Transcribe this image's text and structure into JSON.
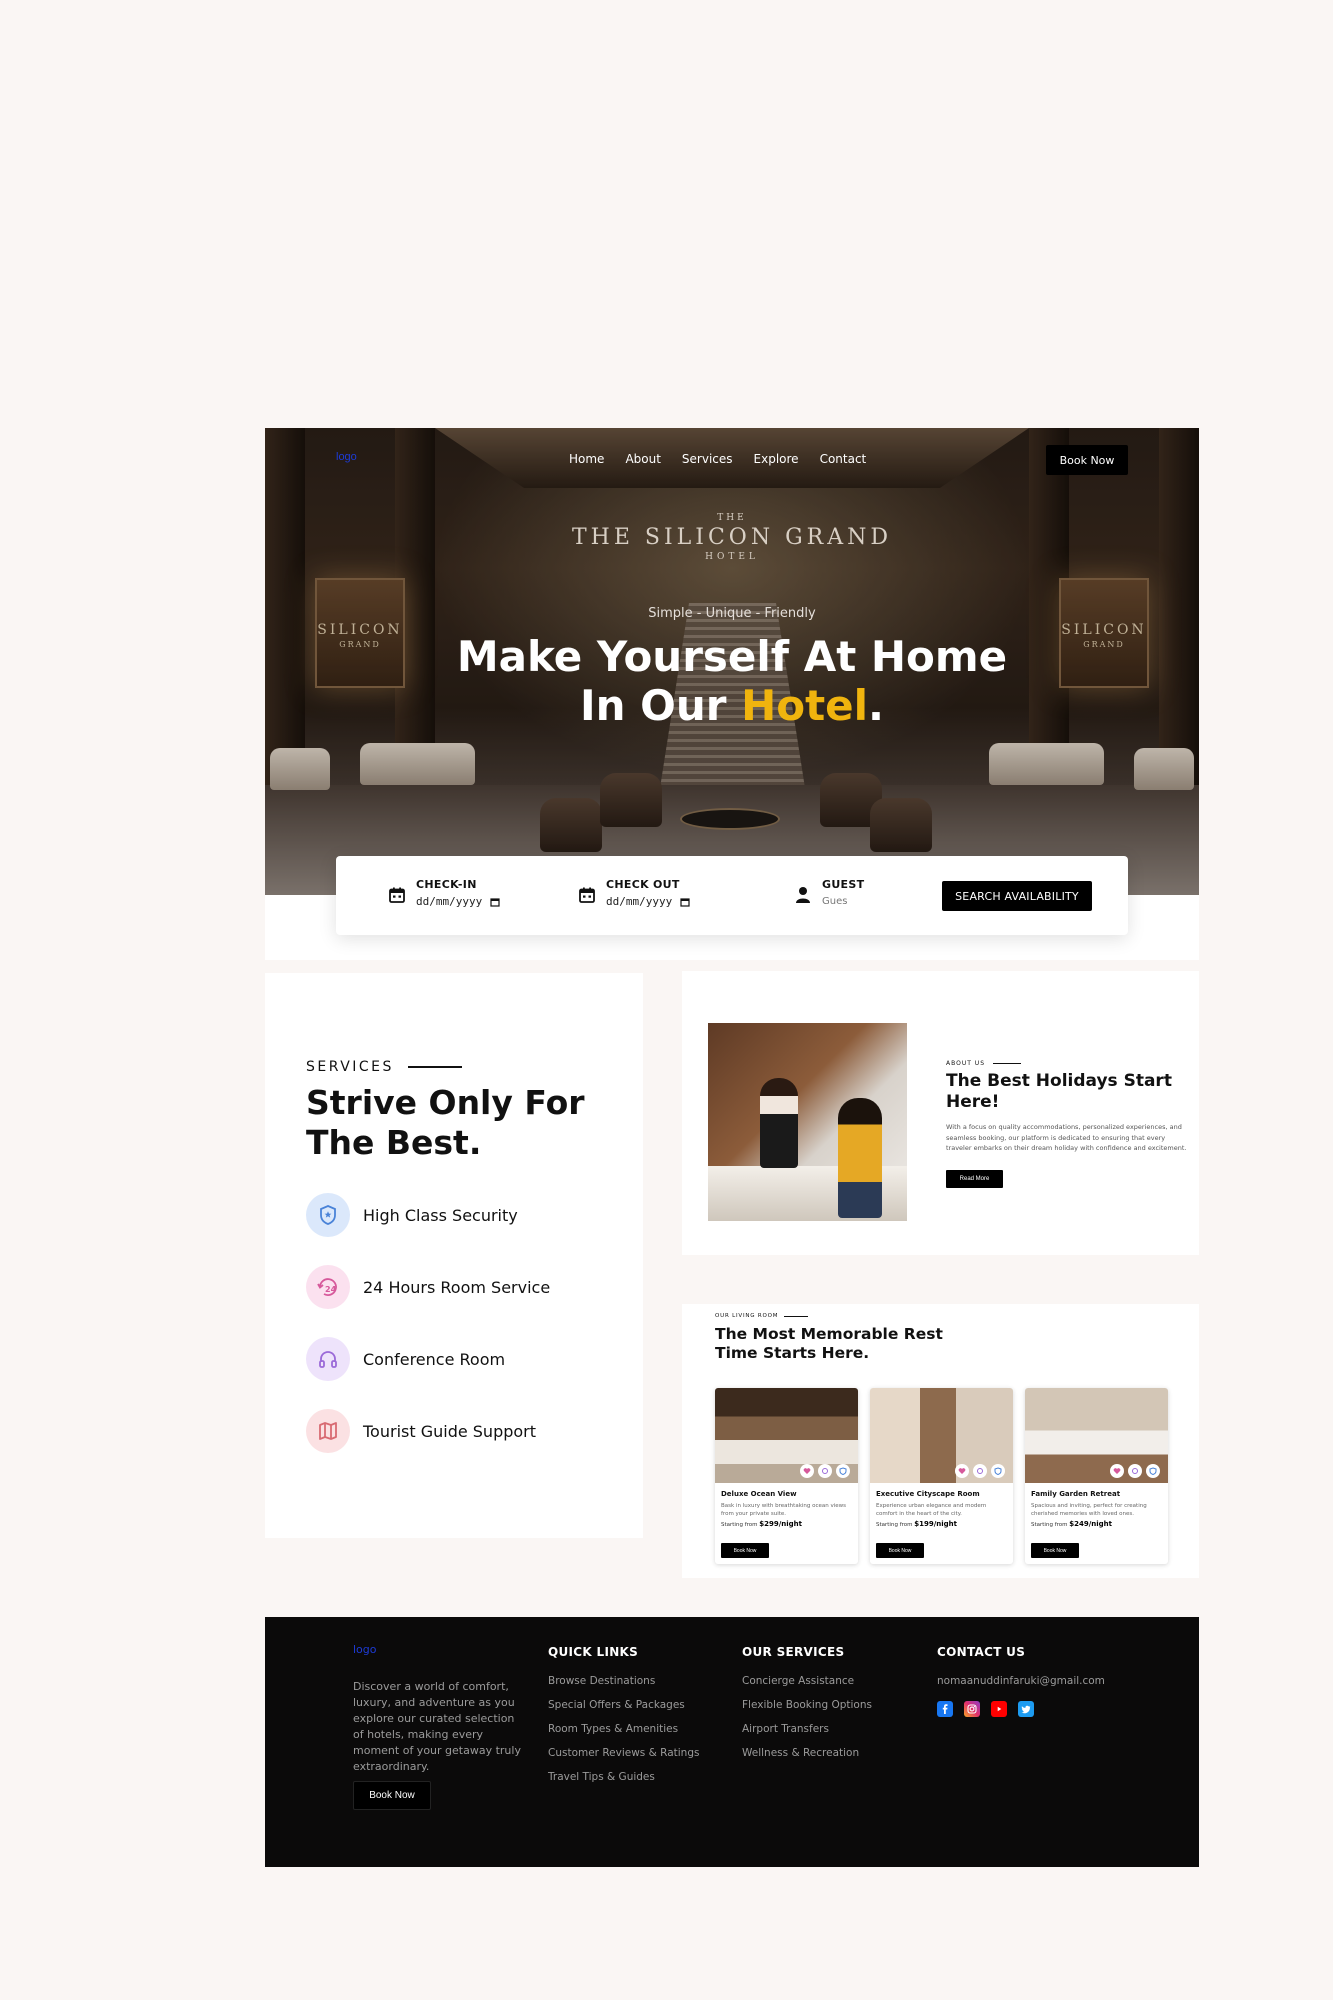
{
  "nav": {
    "logo_alt": "logo",
    "links": [
      "Home",
      "About",
      "Services",
      "Explore",
      "Contact"
    ],
    "book_label": "Book Now"
  },
  "hero": {
    "sign_pre": "THE",
    "sign_main": "THE SILICON GRAND",
    "sign_post": "HOTEL",
    "panel_main": "SILICON",
    "panel_sub": "GRAND",
    "tagline": "Simple - Unique - Friendly",
    "title_line1": "Make Yourself At Home",
    "title_line2_prefix": "In Our ",
    "title_accent": "Hotel",
    "title_suffix": ".",
    "accent_color": "#f0b40e"
  },
  "booking": {
    "checkin_label": "CHECK-IN",
    "checkin_value": "dd/mm/yyyy",
    "checkout_label": "CHECK OUT",
    "checkout_value": "dd/mm/yyyy",
    "guest_label": "GUEST",
    "guest_placeholder": "Gues",
    "search_label": "SEARCH AVAILABILITY"
  },
  "services": {
    "eyebrow": "SERVICES",
    "title": "Strive Only For The Best.",
    "items": [
      {
        "label": "High Class Security",
        "icon": "shield-icon",
        "bg": "#dbe8fb",
        "color": "#4a83d8"
      },
      {
        "label": "24 Hours Room Service",
        "icon": "24-hours-icon",
        "bg": "#fbe1ef",
        "color": "#d6599b"
      },
      {
        "label": "Conference Room",
        "icon": "headphones-icon",
        "bg": "#eee3fb",
        "color": "#9b6ad8"
      },
      {
        "label": "Tourist Guide Support",
        "icon": "map-icon",
        "bg": "#fbe1e3",
        "color": "#d86a72"
      }
    ]
  },
  "about": {
    "eyebrow": "ABOUT US",
    "title": "The Best Holidays Start Here!",
    "text": "With a focus on quality accommodations, personalized experiences, and seamless booking, our platform is dedicated to ensuring that every traveler embarks on their dream holiday with confidence and excitement.",
    "button": "Read More"
  },
  "rooms": {
    "eyebrow": "OUR LIVING ROOM",
    "title": "The Most Memorable Rest Time Starts Here.",
    "items": [
      {
        "name": "Deluxe Ocean View",
        "desc": "Bask in luxury with breathtaking ocean views from your private suite.",
        "price_prefix": "Starting from ",
        "price": "$299",
        "price_suffix": "/night",
        "button": "Book Now"
      },
      {
        "name": "Executive Cityscape Room",
        "desc": "Experience urban elegance and modern comfort in the heart of the city.",
        "price_prefix": "Starting from ",
        "price": "$199",
        "price_suffix": "/night",
        "button": "Book Now"
      },
      {
        "name": "Family Garden Retreat",
        "desc": "Spacious and inviting, perfect for creating cherished memories with loved ones.",
        "price_prefix": "Starting from ",
        "price": "$249",
        "price_suffix": "/night",
        "button": "Book Now"
      }
    ]
  },
  "footer": {
    "logo_alt": "logo",
    "about": "Discover a world of comfort, luxury, and adventure as you explore our curated selection of hotels, making every moment of your getaway truly extraordinary.",
    "book_label": "Book Now",
    "quick_links_title": "QUICK LINKS",
    "quick_links": [
      "Browse Destinations",
      "Special Offers & Packages",
      "Room Types & Amenities",
      "Customer Reviews & Ratings",
      "Travel Tips & Guides"
    ],
    "services_title": "OUR SERVICES",
    "services": [
      "Concierge Assistance",
      "Flexible Booking Options",
      "Airport Transfers",
      "Wellness & Recreation"
    ],
    "contact_title": "CONTACT US",
    "email": "nomaanuddinfaruki@gmail.com",
    "socials": [
      "facebook-icon",
      "instagram-icon",
      "youtube-icon",
      "twitter-icon"
    ]
  }
}
